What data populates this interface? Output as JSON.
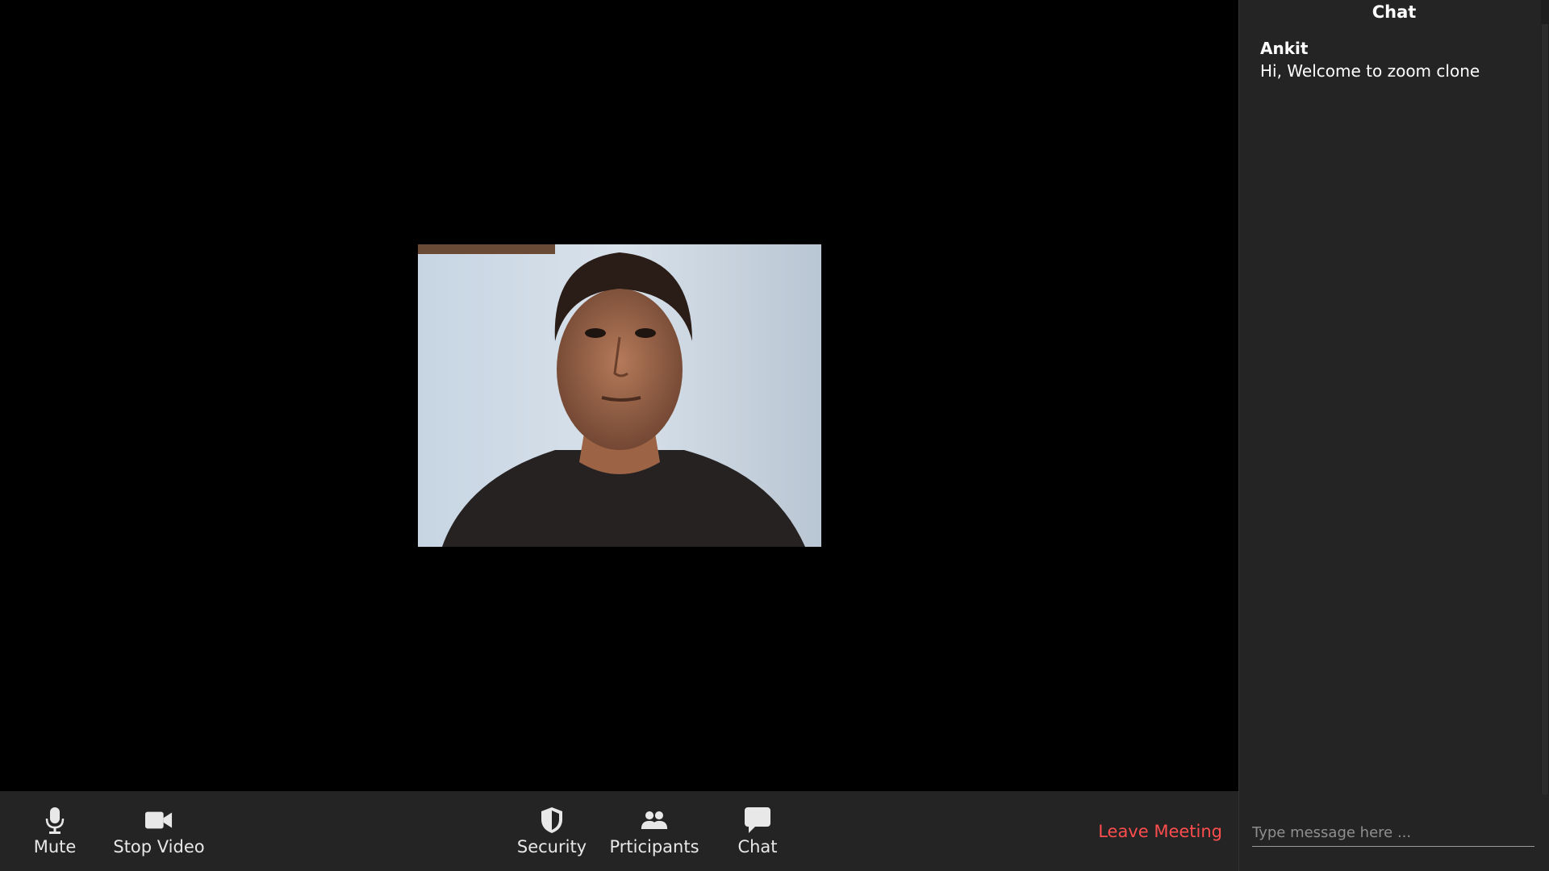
{
  "controls": {
    "mute_label": "Mute",
    "stop_video_label": "Stop Video",
    "security_label": "Security",
    "participants_label": "Prticipants",
    "chat_label": "Chat",
    "leave_label": "Leave Meeting"
  },
  "icons": {
    "mute": "microphone-icon",
    "stop_video": "video-camera-icon",
    "security": "shield-icon",
    "participants": "users-icon",
    "chat": "chat-bubble-icon"
  },
  "chat": {
    "title": "Chat",
    "messages": [
      {
        "name": "Ankit",
        "text": "Hi, Welcome to zoom clone"
      }
    ],
    "input_placeholder": "Type message here ..."
  },
  "colors": {
    "background": "#000000",
    "panel": "#242424",
    "leave_red": "#ff4d4d",
    "text": "#e8e8e8"
  }
}
